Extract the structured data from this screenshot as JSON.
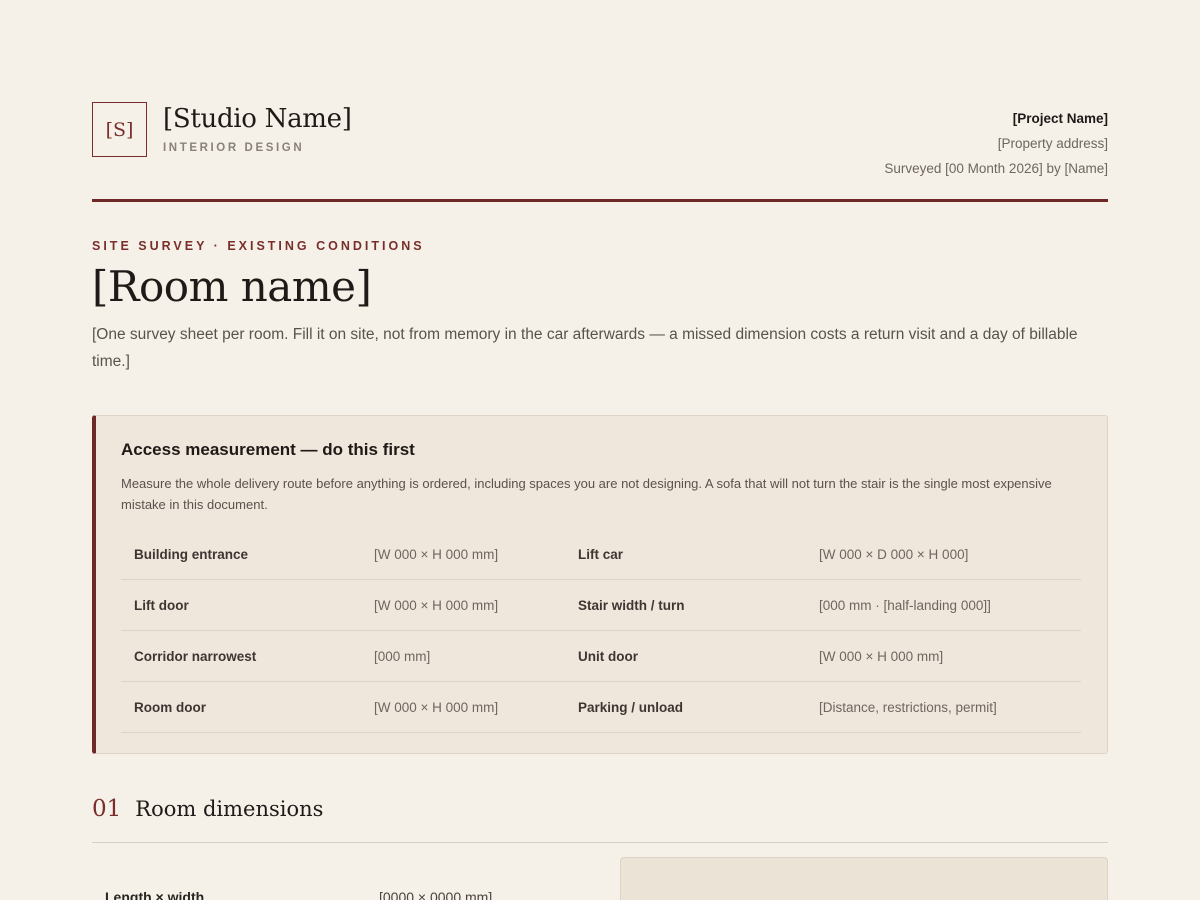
{
  "header": {
    "logo_mark": "[S]",
    "studio_name": "[Studio Name]",
    "studio_subtitle": "INTERIOR DESIGN",
    "project_name": "[Project Name]",
    "property_address": "[Property address]",
    "surveyed_line": "Surveyed [00 Month 2026] by [Name]"
  },
  "document": {
    "kicker": "SITE SURVEY · EXISTING CONDITIONS",
    "room_title": "[Room name]",
    "intro": "[One survey sheet per room. Fill it on site, not from memory in the car afterwards — a missed dimension costs a return visit and a day of billable time.]"
  },
  "access": {
    "title": "Access measurement — do this first",
    "description": "Measure the whole delivery route before anything is ordered, including spaces you are not designing. A sofa that will not turn the stair is the single most expensive mistake in this document.",
    "rows": [
      {
        "label_a": "Building entrance",
        "value_a": "[W 000 × H 000 mm]",
        "label_b": "Lift car",
        "value_b": "[W 000 × D 000 × H 000]"
      },
      {
        "label_a": "Lift door",
        "value_a": "[W 000 × H 000 mm]",
        "label_b": "Stair width / turn",
        "value_b": "[000 mm · [half-landing 000]]"
      },
      {
        "label_a": "Corridor narrowest",
        "value_a": "[000 mm]",
        "label_b": "Unit door",
        "value_b": "[W 000 × H 000 mm]"
      },
      {
        "label_a": "Room door",
        "value_a": "[W 000 × H 000 mm]",
        "label_b": "Parking / unload",
        "value_b": "[Distance, restrictions, permit]"
      }
    ]
  },
  "section_01": {
    "number": "01",
    "title": "Room dimensions",
    "first_row_label": "Length × width",
    "first_row_value": "[0000 × 0000 mm]"
  },
  "colors": {
    "accent": "#7a2e2a",
    "background": "#f5f1e9",
    "card": "#efe7dc"
  }
}
